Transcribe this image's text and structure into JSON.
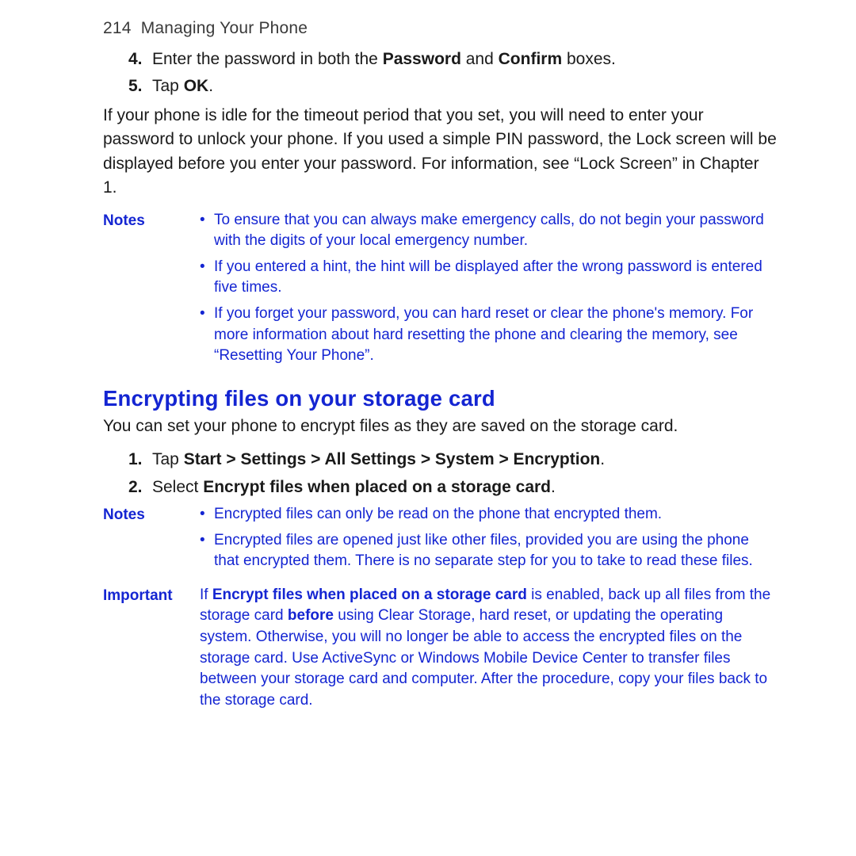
{
  "header": {
    "page_number": "214",
    "section_title": "Managing Your Phone"
  },
  "steps_a": [
    {
      "num": "4.",
      "before": "Enter the password in both the ",
      "bold1": "Password",
      "mid": " and ",
      "bold2": "Confirm",
      "after": " boxes."
    },
    {
      "num": "5.",
      "before": "Tap ",
      "bold1": "OK",
      "mid": "",
      "bold2": "",
      "after": "."
    }
  ],
  "paragraph_a": "If your phone is idle for the timeout period that you set, you will need to enter your password to unlock your phone. If you used a simple PIN password, the Lock screen will be displayed before you enter your password. For information, see “Lock Screen” in Chapter 1.",
  "notes1_label": "Notes",
  "notes1": [
    "To ensure that you can always make emergency calls, do not begin your password with the digits of your local emergency number.",
    "If you entered a hint, the hint will be displayed after the wrong password is entered five times.",
    "If you forget your password, you can hard reset or clear the phone's memory. For more information about hard resetting the phone and clearing the memory, see “Resetting Your Phone”."
  ],
  "section_heading": "Encrypting files on your storage card",
  "paragraph_b": "You can set your phone to encrypt files as they are saved on the storage card.",
  "steps_b": [
    {
      "num": "1.",
      "before": "Tap ",
      "bold1": "Start > Settings > All Settings > System > Encryption",
      "mid": "",
      "bold2": "",
      "after": "."
    },
    {
      "num": "2.",
      "before": "Select ",
      "bold1": "Encrypt files when placed on a storage card",
      "mid": "",
      "bold2": "",
      "after": "."
    }
  ],
  "notes2_label": "Notes",
  "notes2": [
    "Encrypted files can only be read on the phone that encrypted them.",
    "Encrypted files are opened just like other files, provided you are using the phone that encrypted them. There is no separate step for you to take to read these files."
  ],
  "important_label": "Important",
  "important": {
    "pre": "If ",
    "bold1": "Encrypt files when placed on a storage card",
    "mid1": " is enabled, back up all files from the storage card ",
    "bold2": "before",
    "mid2": " using Clear Storage, hard reset, or updating the operating system. Otherwise, you will no longer be able to access the encrypted files on the storage card. Use ActiveSync or Windows Mobile Device Center to transfer files between your storage card and computer. After the procedure, copy your files back to the storage card."
  }
}
